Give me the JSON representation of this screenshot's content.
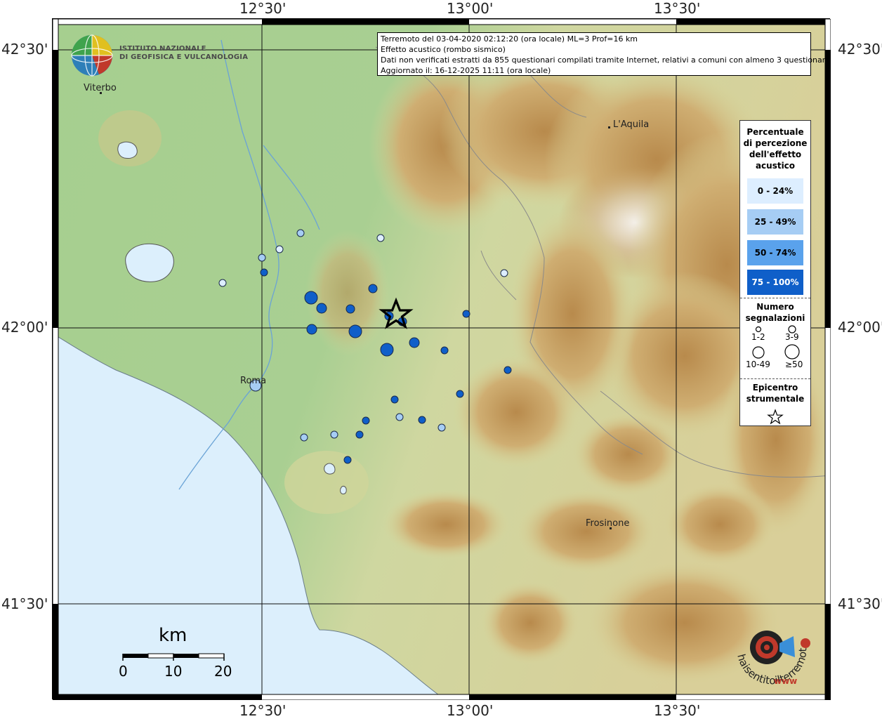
{
  "info": {
    "line1": "Terremoto del 03-04-2020 02:12:20 (ora locale) ML=3 Prof=16 km",
    "line2": "Effetto acustico (rombo sismico)",
    "line3": "Dati non verificati estratti da 855 questionari compilati tramite Internet, relativi a comuni con almeno 3 questionari.",
    "line4": "Aggiornato il: 16-12-2025 11:11 (ora locale)"
  },
  "coords": {
    "top": [
      "12°30'",
      "13°00'",
      "13°30'"
    ],
    "bottom": [
      "12°30'",
      "13°00'",
      "13°30'"
    ],
    "left": [
      "42°30'",
      "42°00'",
      "41°30'"
    ],
    "right": [
      "42°30'",
      "42°00'",
      "41°30'"
    ]
  },
  "institute": {
    "line1": "ISTITUTO NAZIONALE",
    "line2": "DI GEOFISICA E VULCANOLOGIA"
  },
  "cities": {
    "viterbo": "Viterbo",
    "laquila": "L'Aquila",
    "roma": "Roma",
    "frosinone": "Frosinone"
  },
  "legend": {
    "title1": "Percentuale",
    "title2": "di percezione",
    "title3": "dell'effetto",
    "title4": "acustico",
    "classes": [
      {
        "label": "0 - 24%",
        "color": "#ddeeff"
      },
      {
        "label": "25 - 49%",
        "color": "#a6cdf4"
      },
      {
        "label": "50 - 74%",
        "color": "#5aa2ec"
      },
      {
        "label": "75 - 100%",
        "color": "#0f5fc9"
      }
    ],
    "count_title1": "Numero",
    "count_title2": "segnalazioni",
    "sizes": [
      "1-2",
      "3-9",
      "10-49",
      "≥50"
    ],
    "epi_title1": "Epicentro",
    "epi_title2": "strumentale"
  },
  "scale": {
    "unit": "km",
    "ticks": [
      "0",
      "10",
      "20"
    ]
  },
  "brand": {
    "text1": "haisentitoilterremoto.it",
    "text2": "www"
  },
  "colors": {
    "sea": "#dceffc",
    "lowland": "#9dc98a",
    "hills": "#d8d59a",
    "mountains": "#c09a5a",
    "river": "#6aa3d6"
  }
}
